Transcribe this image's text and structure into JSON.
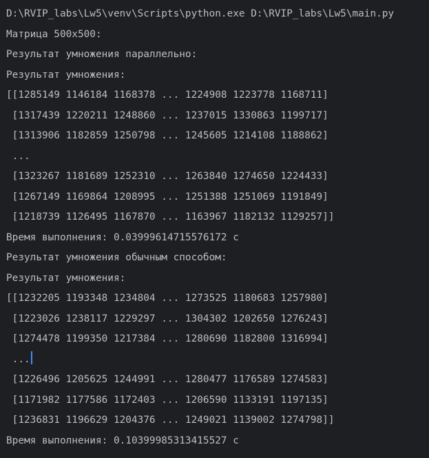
{
  "console": {
    "lines": [
      "D:\\RVIP_labs\\Lw5\\venv\\Scripts\\python.exe D:\\RVIP_labs\\Lw5\\main.py",
      "Матрица 500x500:",
      "Результат умножения параллельно:",
      "Результат умножения:",
      "[[1285149 1146184 1168378 ... 1224908 1223778 1168711]",
      " [1317439 1220211 1248860 ... 1237015 1330863 1199717]",
      " [1313906 1182859 1250798 ... 1245605 1214108 1188862]",
      " ...",
      " [1323267 1181689 1252310 ... 1263840 1274650 1224433]",
      " [1267149 1169864 1208995 ... 1251388 1251069 1191849]",
      " [1218739 1126495 1167870 ... 1163967 1182132 1129257]]",
      "Время выполнения: 0.03999614715576172 с",
      "Результат умножения обычным способом:",
      "Результат умножения:",
      "[[1232205 1193348 1234804 ... 1273525 1180683 1257980]",
      " [1223026 1238117 1229297 ... 1304302 1202650 1276243]",
      " [1274478 1199350 1217384 ... 1280690 1182800 1316994]",
      " ...",
      " [1226496 1205625 1244991 ... 1280477 1176589 1274583]",
      " [1171982 1177586 1172403 ... 1206590 1133191 1197135]",
      " [1236831 1196629 1204376 ... 1249021 1139002 1274798]]",
      "Время выполнения: 0.10399985313415527 с"
    ]
  },
  "colors": {
    "background": "#1e1f22",
    "text": "#bcbec4",
    "caret": "#4a88ff"
  }
}
